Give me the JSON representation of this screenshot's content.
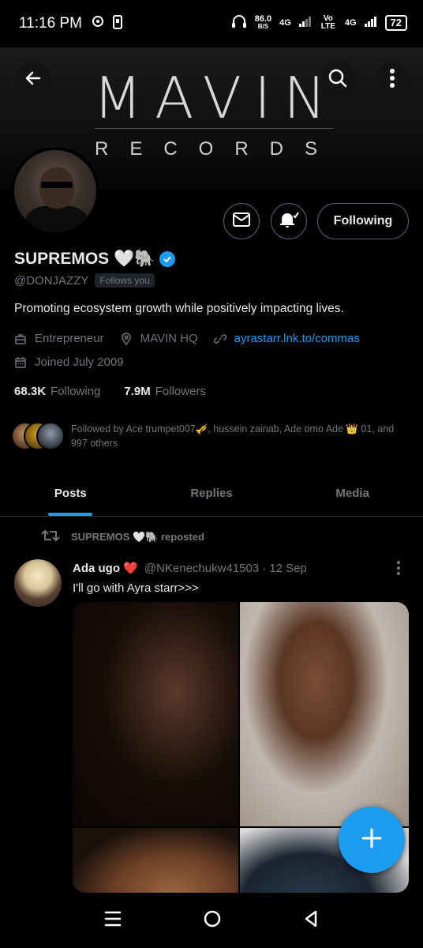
{
  "status_bar": {
    "time": "11:16 PM",
    "net_speed": "86.0",
    "net_unit": "B/S",
    "sim1": "4G",
    "volte": "Vo LTE",
    "sim2": "4G",
    "battery": "72"
  },
  "banner": {
    "logo_main": "MAVIN",
    "logo_sub": "RECORDS"
  },
  "profile": {
    "name": "SUPREMOS 🤍🐘",
    "handle": "@DONJAZZY",
    "follows_you": "Follows you",
    "bio": "Promoting ecosystem growth while positively impacting lives.",
    "category": "Entrepreneur",
    "location": "MAVIN HQ",
    "website": "ayrastarr.lnk.to/commas",
    "joined": "Joined July 2009",
    "following_count": "68.3K",
    "following_label": "Following",
    "followers_count": "7.9M",
    "followers_label": "Followers",
    "follow_button": "Following",
    "followed_by": "Followed by Ace trumpet007🎺, hussein zainab, Ade omo Ade 👑 01, and 997 others"
  },
  "tabs": [
    {
      "label": "Posts",
      "active": true
    },
    {
      "label": "Replies",
      "active": false
    },
    {
      "label": "Media",
      "active": false
    }
  ],
  "post": {
    "repost_label": "SUPREMOS 🤍🐘 reposted",
    "author_name": "Ada ugo ❤️",
    "author_handle": "@NKenechukw41503",
    "date": "· 12 Sep",
    "text": "I'll go with Ayra starr>>>"
  },
  "colors": {
    "accent": "#1d9bf0",
    "muted": "#71767b",
    "text": "#e7e9ea",
    "background": "#000000"
  },
  "icons": [
    "back-arrow-icon",
    "search-icon",
    "more-vertical-icon",
    "mail-icon",
    "notification-bell-icon",
    "briefcase-icon",
    "location-pin-icon",
    "link-icon",
    "calendar-icon",
    "verified-badge-icon",
    "repost-icon",
    "compose-plus-icon",
    "menu-icon",
    "home-circle-icon",
    "back-triangle-icon"
  ]
}
